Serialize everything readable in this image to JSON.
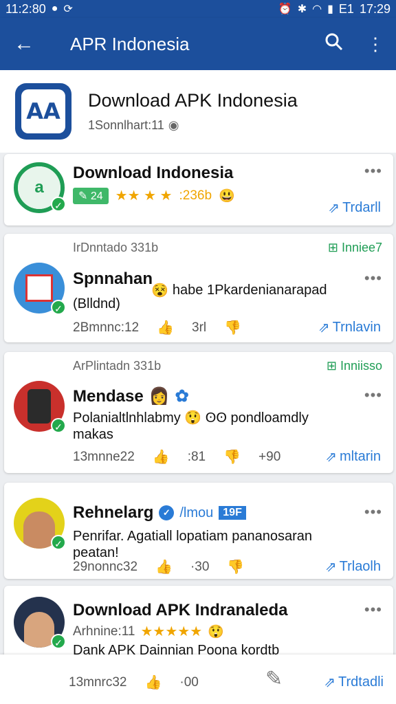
{
  "status_bar": {
    "time_left": "11:2:80",
    "time_right": "17:29",
    "sim_label": "E1"
  },
  "app_bar": {
    "title": "APR Indonesia",
    "back_icon": "arrow-left-icon",
    "search_icon": "search-icon",
    "menu_icon": "more-vertical-icon"
  },
  "page": {
    "logo_text": "AA",
    "title": "Download APK Indonesia",
    "subtitle": "1Sonnlhart:11"
  },
  "posts": [
    {
      "name": "Download Indonesia",
      "chip": "24",
      "rating_text": ":236b",
      "share": "Trdarll"
    },
    {
      "meta": "IrDnntado 331b",
      "meta_right": "Inniee7",
      "name": "Spnnahan",
      "inline_text": "habe 1Pkardenianarapad",
      "body": "(Blldnd)",
      "stat1": "2Bmnnc:12",
      "stat2": "3rl",
      "share": "Trnlavin"
    },
    {
      "meta": "ArPlintadn 331b",
      "meta_right": "Inniisso",
      "name": "Mendase",
      "body": "Polanialtlnhlabmy 😲 ʘʘ pondloamdly makas",
      "stat1": "13mnne22",
      "stat2": ":81",
      "stat3": "+90",
      "share": "mltarin"
    },
    {
      "name": "Rehnelarg",
      "handle": "/lmou",
      "badge": "19F",
      "body": "Penrifar. Agatiall lopatiam pananosaran peatan!",
      "stat1": "29nonnc32",
      "stat2": "·30",
      "share": "Trlaolh"
    },
    {
      "name": "Download APK Indranaleda",
      "meta": "Arhnine:11",
      "body": "Dank APK Dainnian Poona kordtb mabes",
      "stat1": "13mnrc32",
      "stat2": "·00",
      "share": "Trdtadli"
    }
  ],
  "colors": {
    "primary": "#1c4f9c",
    "accent_green": "#23a94c",
    "link_blue": "#2a7bd6",
    "star": "#f0a500"
  }
}
